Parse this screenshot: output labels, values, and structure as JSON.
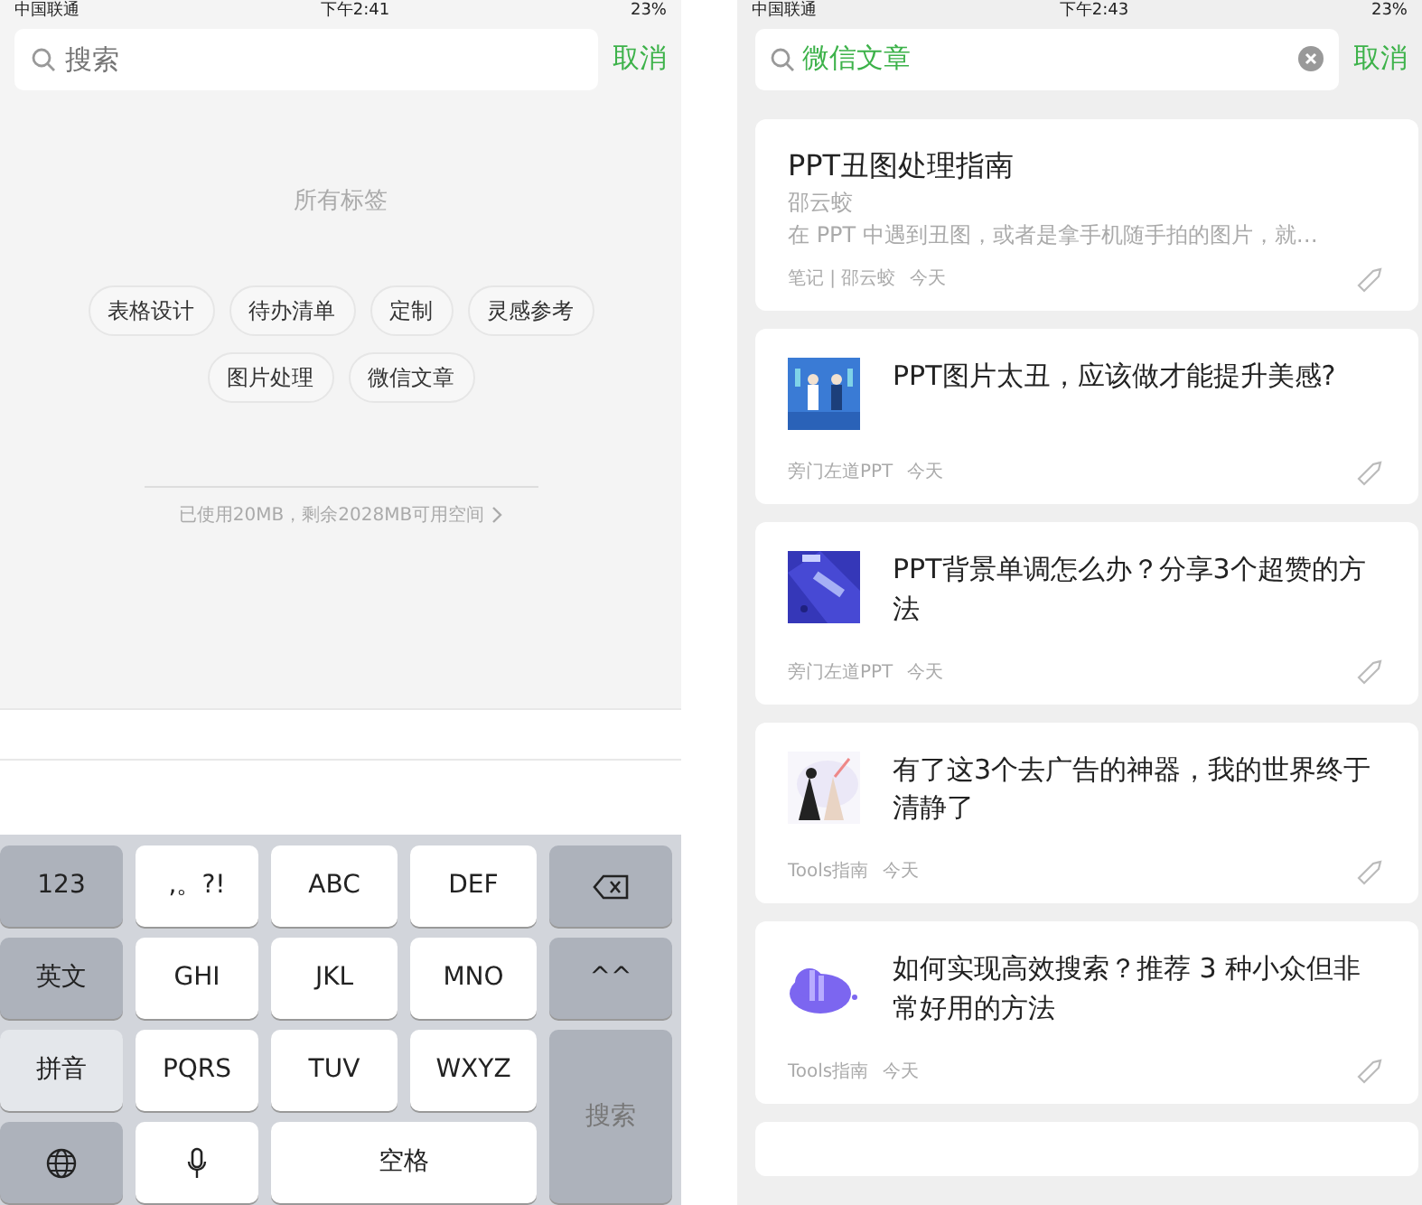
{
  "left_screen": {
    "status_bar": {
      "carrier": "中国联通",
      "time": "下午2:41",
      "battery": "23%"
    },
    "search": {
      "placeholder": "搜索",
      "cancel": "取消"
    },
    "tags_heading": "所有标签",
    "tags": [
      {
        "label": "表格设计"
      },
      {
        "label": "待办清单"
      },
      {
        "label": "定制"
      },
      {
        "label": "灵感参考"
      },
      {
        "label": "图片处理"
      },
      {
        "label": "微信文章"
      }
    ],
    "storage": "已使用20MB，剩余2028MB可用空间",
    "keyboard": [
      {
        "label": "123",
        "kind": "function",
        "selected": false
      },
      {
        "label": ",。?!",
        "kind": "letter",
        "selected": false
      },
      {
        "label": "ABC",
        "kind": "letter",
        "selected": false
      },
      {
        "label": "DEF",
        "kind": "letter",
        "selected": false
      },
      {
        "kind": "backspace",
        "selected": false
      },
      {
        "label": "英文",
        "kind": "function",
        "selected": false
      },
      {
        "label": "GHI",
        "kind": "letter",
        "selected": false
      },
      {
        "label": "JKL",
        "kind": "letter",
        "selected": false
      },
      {
        "label": "MNO",
        "kind": "letter",
        "selected": false
      },
      {
        "label": "^^",
        "kind": "function",
        "selected": false
      },
      {
        "label": "拼音",
        "kind": "function",
        "selected": true
      },
      {
        "label": "PQRS",
        "kind": "letter",
        "selected": false
      },
      {
        "label": "TUV",
        "kind": "letter",
        "selected": false
      },
      {
        "label": "WXYZ",
        "kind": "letter",
        "selected": false
      },
      {
        "label": "搜索",
        "kind": "search",
        "selected": false
      },
      {
        "kind": "globe",
        "selected": false
      },
      {
        "kind": "mic",
        "selected": false
      },
      {
        "label": "空格",
        "kind": "space",
        "selected": false
      }
    ]
  },
  "right_screen": {
    "status_bar": {
      "carrier": "中国联通",
      "time": "下午2:43",
      "battery": "23%"
    },
    "search": {
      "value": "微信文章",
      "cancel": "取消"
    },
    "results": [
      {
        "kind": "note",
        "title": "PPT丑图处理指南",
        "author": "邵云蛟",
        "excerpt": "在 PPT 中遇到丑图，或者是拿手机随手拍的图片，就…",
        "source": "笔记 | 邵云蛟",
        "date": "今天"
      },
      {
        "kind": "article",
        "title": "PPT图片太丑，应该做才能提升美感?",
        "source": "旁门左道PPT",
        "date": "今天"
      },
      {
        "kind": "article",
        "title": "PPT背景单调怎么办？分享3个超赞的方法",
        "source": "旁门左道PPT",
        "date": "今天"
      },
      {
        "kind": "article",
        "title": "有了这3个去广告的神器，我的世界终于清静了",
        "source": "Tools指南",
        "date": "今天"
      },
      {
        "kind": "article",
        "title": "如何实现高效搜索？推荐 3 种小众但非常好用的方法",
        "source": "Tools指南",
        "date": "今天"
      },
      {
        "kind": "empty"
      }
    ]
  }
}
